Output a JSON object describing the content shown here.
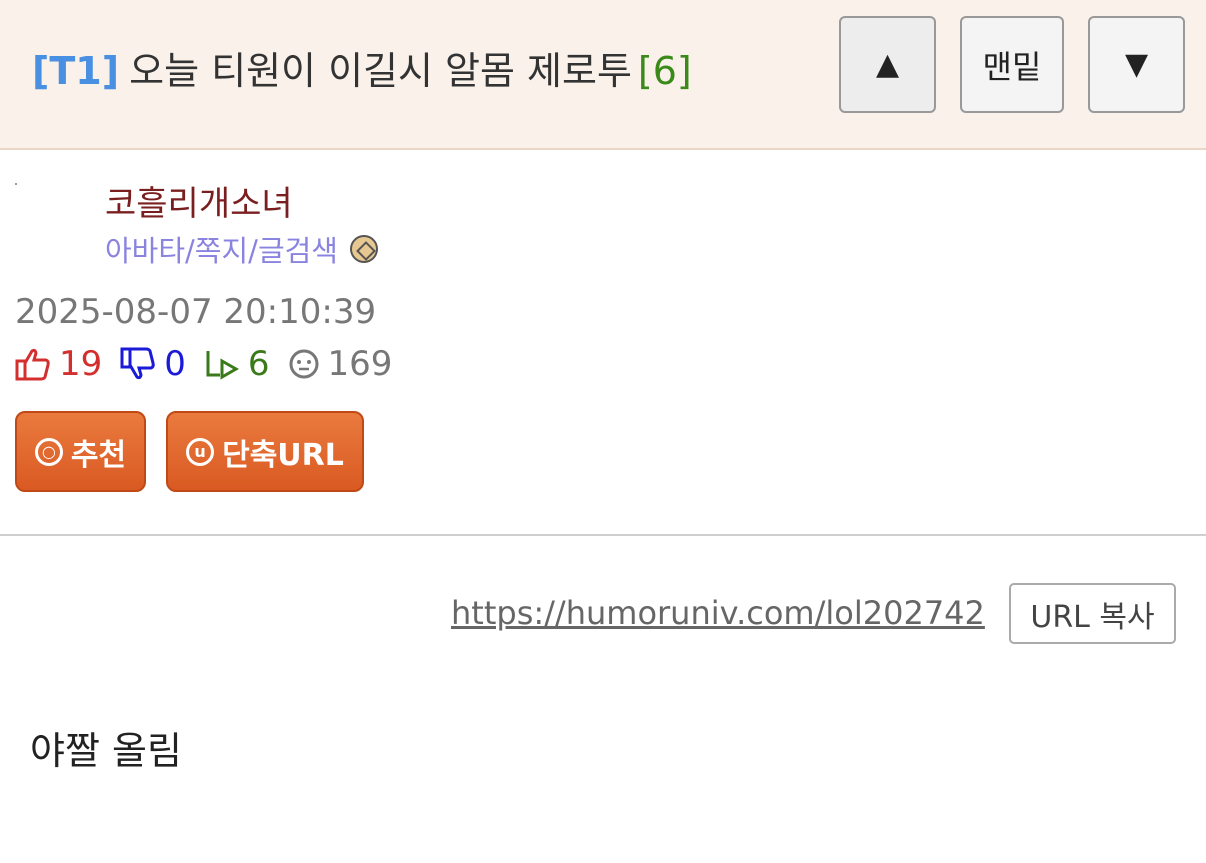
{
  "post": {
    "tag": "[T1]",
    "title": "오늘 티원이 이길시 알몸 제로투",
    "comment_count": "[6]"
  },
  "nav": {
    "up_label": "▲",
    "bottom_label": "맨밑",
    "down_label": "▼"
  },
  "author": {
    "name": "코흘리개소녀",
    "links": "아바타/쪽지/글검색"
  },
  "timestamp": "2025-08-07 20:10:39",
  "stats": {
    "upvotes": "19",
    "downvotes": "0",
    "replies": "6",
    "views": "169"
  },
  "actions": {
    "recommend_icon": "ⓞ",
    "recommend_label": "추천",
    "shorturl_icon": "u",
    "shorturl_label": "단축URL"
  },
  "share": {
    "url": "https://humoruniv.com/lol202742",
    "copy_label": "URL 복사"
  },
  "body": {
    "text": "야짤 올림"
  },
  "colors": {
    "header_bg": "#f9f1ea",
    "tag": "#4a90e2",
    "count": "#3a8a1a",
    "author": "#7a1f1f",
    "links": "#8a84e0",
    "button": "#e06a2e"
  }
}
